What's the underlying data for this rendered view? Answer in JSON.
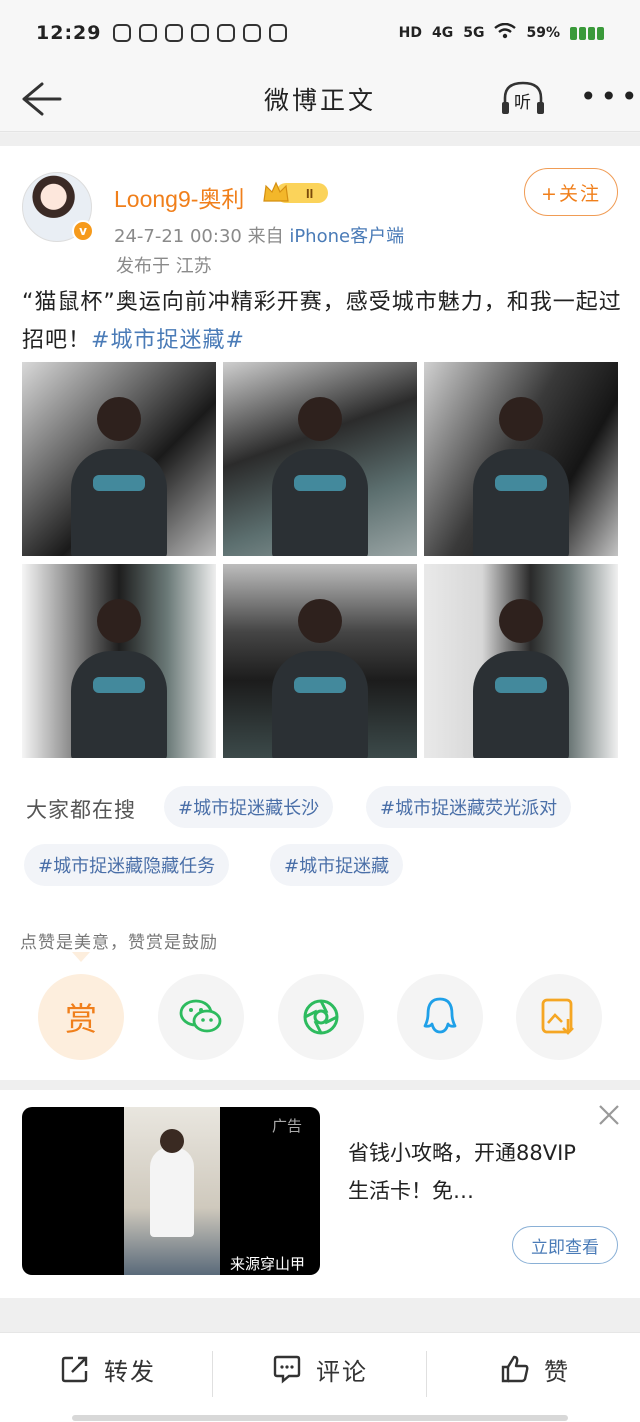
{
  "status_bar": {
    "time": "12:29",
    "network_1": "HD",
    "network_2": "4G",
    "network_3": "5G",
    "battery": "59%"
  },
  "nav": {
    "title": "微博正文",
    "listen_label": "听"
  },
  "post": {
    "username": "Loong9-奥利",
    "vip_level": "II",
    "timestamp": "24-7-21 00:30",
    "from_prefix": "来自",
    "source": "iPhone客户端",
    "location": "发布于 江苏",
    "follow_label": "+关注",
    "text_body": "“猫鼠杯”奥运向前冲精彩开赛，感受城市魅力，和我一起过招吧！",
    "text_tag": "#城市捉迷藏#"
  },
  "search": {
    "label": "大家都在搜",
    "chips": [
      "#城市捉迷藏长沙",
      "#城市捉迷藏荧光派对",
      "#城市捉迷藏隐藏任务",
      "#城市捉迷藏"
    ]
  },
  "reward": {
    "caption": "点赞是美意，赞赏是鼓励",
    "reward_label": "赏"
  },
  "ad": {
    "tag": "广告",
    "source": "来源穿山甲",
    "title": "省钱小攻略，开通88VIP生活卡！免…",
    "cta": "立即查看"
  },
  "actions": {
    "repost": "转发",
    "comment": "评论",
    "like": "赞"
  },
  "colors": {
    "accent": "#f07f1b",
    "link": "#4a7bb7"
  }
}
